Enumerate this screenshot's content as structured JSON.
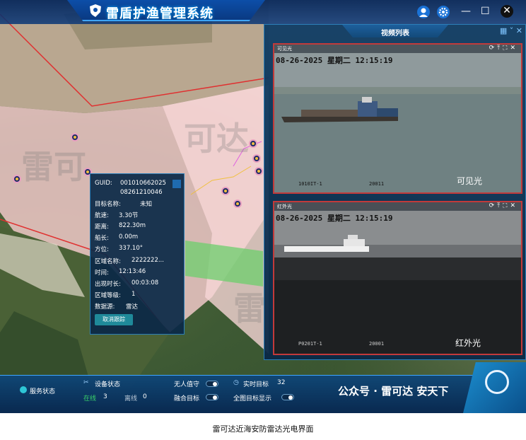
{
  "app": {
    "title": "雷盾护渔管理系统"
  },
  "video_panel": {
    "title": "视频列表",
    "visible": {
      "name": "可见光",
      "osd_time": "08-26-2025 星期二 12:15:19",
      "osd_left": "1010IT-1",
      "osd_mid": "20011",
      "label": "可见光"
    },
    "infrared": {
      "name": "红外光",
      "osd_time": "08-26-2025 星期二 12:15:19",
      "osd_left": "P0201T-1",
      "osd_mid": "20001",
      "label": "红外光"
    }
  },
  "popup": {
    "guid_label": "GUID:",
    "guid_line1": "001010662025",
    "guid_line2": "08261210046",
    "rows": [
      {
        "k": "目标名称:",
        "v": "未知"
      },
      {
        "k": "航速:",
        "v": "3.30节"
      },
      {
        "k": "距离:",
        "v": "822.30m"
      },
      {
        "k": "船长:",
        "v": "0.00m"
      },
      {
        "k": "方位:",
        "v": "337.10°"
      },
      {
        "k": "区域名称:",
        "v": "2222222..."
      },
      {
        "k": "时间:",
        "v": "12:13:46"
      },
      {
        "k": "出现时长:",
        "v": "00:03:08"
      },
      {
        "k": "区域等级:",
        "v": "1"
      },
      {
        "k": "数据源:",
        "v": "雷达"
      }
    ],
    "cancel_label": "取消跟踪"
  },
  "bottom": {
    "service_status": "服务状态",
    "device_status": "设备状态",
    "online_label": "在线",
    "online_count": "3",
    "offline_label": "离线",
    "offline_count": "0",
    "unmanned_label": "无人值守",
    "fusion_label": "融合目标",
    "realtime_label": "实时目标",
    "realtime_count": "32",
    "all_targets_label": "全图目标显示"
  },
  "overlay": {
    "social_text": "公众号 · 雷可达 安天下",
    "watermark": "雷可达"
  },
  "caption": "雷可达近海安防雷达光电界面",
  "colors": {
    "accent": "#2c7fb8",
    "frame_alert": "#c23a3a",
    "panel_bg": "#0e3c64"
  }
}
